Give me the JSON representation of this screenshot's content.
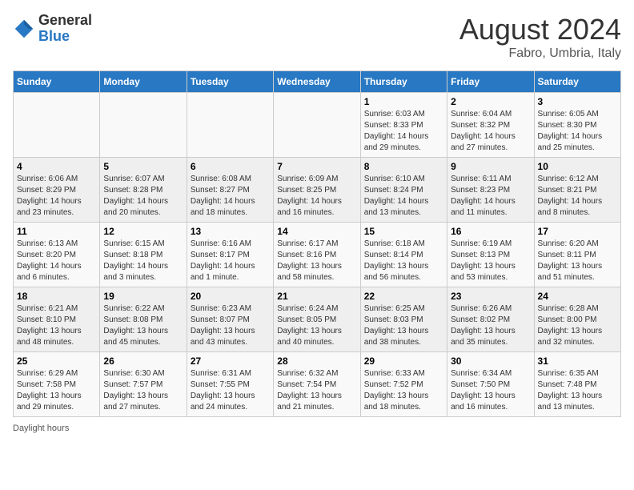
{
  "header": {
    "logo_general": "General",
    "logo_blue": "Blue",
    "month_year": "August 2024",
    "location": "Fabro, Umbria, Italy"
  },
  "days_of_week": [
    "Sunday",
    "Monday",
    "Tuesday",
    "Wednesday",
    "Thursday",
    "Friday",
    "Saturday"
  ],
  "weeks": [
    [
      {
        "day": "",
        "info": ""
      },
      {
        "day": "",
        "info": ""
      },
      {
        "day": "",
        "info": ""
      },
      {
        "day": "",
        "info": ""
      },
      {
        "day": "1",
        "info": "Sunrise: 6:03 AM\nSunset: 8:33 PM\nDaylight: 14 hours and 29 minutes."
      },
      {
        "day": "2",
        "info": "Sunrise: 6:04 AM\nSunset: 8:32 PM\nDaylight: 14 hours and 27 minutes."
      },
      {
        "day": "3",
        "info": "Sunrise: 6:05 AM\nSunset: 8:30 PM\nDaylight: 14 hours and 25 minutes."
      }
    ],
    [
      {
        "day": "4",
        "info": "Sunrise: 6:06 AM\nSunset: 8:29 PM\nDaylight: 14 hours and 23 minutes."
      },
      {
        "day": "5",
        "info": "Sunrise: 6:07 AM\nSunset: 8:28 PM\nDaylight: 14 hours and 20 minutes."
      },
      {
        "day": "6",
        "info": "Sunrise: 6:08 AM\nSunset: 8:27 PM\nDaylight: 14 hours and 18 minutes."
      },
      {
        "day": "7",
        "info": "Sunrise: 6:09 AM\nSunset: 8:25 PM\nDaylight: 14 hours and 16 minutes."
      },
      {
        "day": "8",
        "info": "Sunrise: 6:10 AM\nSunset: 8:24 PM\nDaylight: 14 hours and 13 minutes."
      },
      {
        "day": "9",
        "info": "Sunrise: 6:11 AM\nSunset: 8:23 PM\nDaylight: 14 hours and 11 minutes."
      },
      {
        "day": "10",
        "info": "Sunrise: 6:12 AM\nSunset: 8:21 PM\nDaylight: 14 hours and 8 minutes."
      }
    ],
    [
      {
        "day": "11",
        "info": "Sunrise: 6:13 AM\nSunset: 8:20 PM\nDaylight: 14 hours and 6 minutes."
      },
      {
        "day": "12",
        "info": "Sunrise: 6:15 AM\nSunset: 8:18 PM\nDaylight: 14 hours and 3 minutes."
      },
      {
        "day": "13",
        "info": "Sunrise: 6:16 AM\nSunset: 8:17 PM\nDaylight: 14 hours and 1 minute."
      },
      {
        "day": "14",
        "info": "Sunrise: 6:17 AM\nSunset: 8:16 PM\nDaylight: 13 hours and 58 minutes."
      },
      {
        "day": "15",
        "info": "Sunrise: 6:18 AM\nSunset: 8:14 PM\nDaylight: 13 hours and 56 minutes."
      },
      {
        "day": "16",
        "info": "Sunrise: 6:19 AM\nSunset: 8:13 PM\nDaylight: 13 hours and 53 minutes."
      },
      {
        "day": "17",
        "info": "Sunrise: 6:20 AM\nSunset: 8:11 PM\nDaylight: 13 hours and 51 minutes."
      }
    ],
    [
      {
        "day": "18",
        "info": "Sunrise: 6:21 AM\nSunset: 8:10 PM\nDaylight: 13 hours and 48 minutes."
      },
      {
        "day": "19",
        "info": "Sunrise: 6:22 AM\nSunset: 8:08 PM\nDaylight: 13 hours and 45 minutes."
      },
      {
        "day": "20",
        "info": "Sunrise: 6:23 AM\nSunset: 8:07 PM\nDaylight: 13 hours and 43 minutes."
      },
      {
        "day": "21",
        "info": "Sunrise: 6:24 AM\nSunset: 8:05 PM\nDaylight: 13 hours and 40 minutes."
      },
      {
        "day": "22",
        "info": "Sunrise: 6:25 AM\nSunset: 8:03 PM\nDaylight: 13 hours and 38 minutes."
      },
      {
        "day": "23",
        "info": "Sunrise: 6:26 AM\nSunset: 8:02 PM\nDaylight: 13 hours and 35 minutes."
      },
      {
        "day": "24",
        "info": "Sunrise: 6:28 AM\nSunset: 8:00 PM\nDaylight: 13 hours and 32 minutes."
      }
    ],
    [
      {
        "day": "25",
        "info": "Sunrise: 6:29 AM\nSunset: 7:58 PM\nDaylight: 13 hours and 29 minutes."
      },
      {
        "day": "26",
        "info": "Sunrise: 6:30 AM\nSunset: 7:57 PM\nDaylight: 13 hours and 27 minutes."
      },
      {
        "day": "27",
        "info": "Sunrise: 6:31 AM\nSunset: 7:55 PM\nDaylight: 13 hours and 24 minutes."
      },
      {
        "day": "28",
        "info": "Sunrise: 6:32 AM\nSunset: 7:54 PM\nDaylight: 13 hours and 21 minutes."
      },
      {
        "day": "29",
        "info": "Sunrise: 6:33 AM\nSunset: 7:52 PM\nDaylight: 13 hours and 18 minutes."
      },
      {
        "day": "30",
        "info": "Sunrise: 6:34 AM\nSunset: 7:50 PM\nDaylight: 13 hours and 16 minutes."
      },
      {
        "day": "31",
        "info": "Sunrise: 6:35 AM\nSunset: 7:48 PM\nDaylight: 13 hours and 13 minutes."
      }
    ]
  ],
  "footer": {
    "daylight_label": "Daylight hours"
  }
}
